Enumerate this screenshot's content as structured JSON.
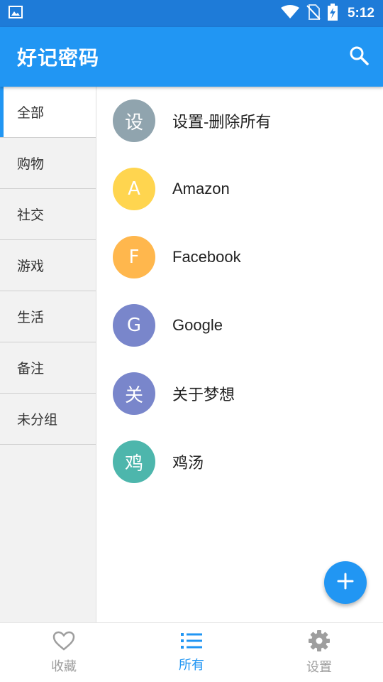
{
  "status_bar": {
    "time": "5:12",
    "icons": [
      "image-icon",
      "wifi-icon",
      "no-sim-icon",
      "battery-charging-icon"
    ]
  },
  "app_bar": {
    "title": "好记密码",
    "search_icon": "search-icon"
  },
  "sidebar": {
    "items": [
      {
        "label": "全部",
        "active": true
      },
      {
        "label": "购物",
        "active": false
      },
      {
        "label": "社交",
        "active": false
      },
      {
        "label": "游戏",
        "active": false
      },
      {
        "label": "生活",
        "active": false
      },
      {
        "label": "备注",
        "active": false
      },
      {
        "label": "未分组",
        "active": false
      }
    ]
  },
  "entries": [
    {
      "initial": "设",
      "name": "设置-删除所有",
      "color": "#90a4ae"
    },
    {
      "initial": "A",
      "name": "Amazon",
      "color": "#ffd54f"
    },
    {
      "initial": "F",
      "name": "Facebook",
      "color": "#ffb74d"
    },
    {
      "initial": "G",
      "name": "Google",
      "color": "#7986cb"
    },
    {
      "initial": "关",
      "name": "关于梦想",
      "color": "#7986cb"
    },
    {
      "initial": "鸡",
      "name": "鸡汤",
      "color": "#4db6ac"
    }
  ],
  "fab": {
    "icon": "plus-icon"
  },
  "bottom_nav": {
    "items": [
      {
        "label": "收藏",
        "icon": "heart-icon",
        "active": false
      },
      {
        "label": "所有",
        "icon": "list-icon",
        "active": true
      },
      {
        "label": "设置",
        "icon": "gear-icon",
        "active": false
      }
    ]
  },
  "colors": {
    "primary": "#2196f3",
    "status_bar": "#1e7bd8",
    "inactive": "#9e9e9e"
  }
}
